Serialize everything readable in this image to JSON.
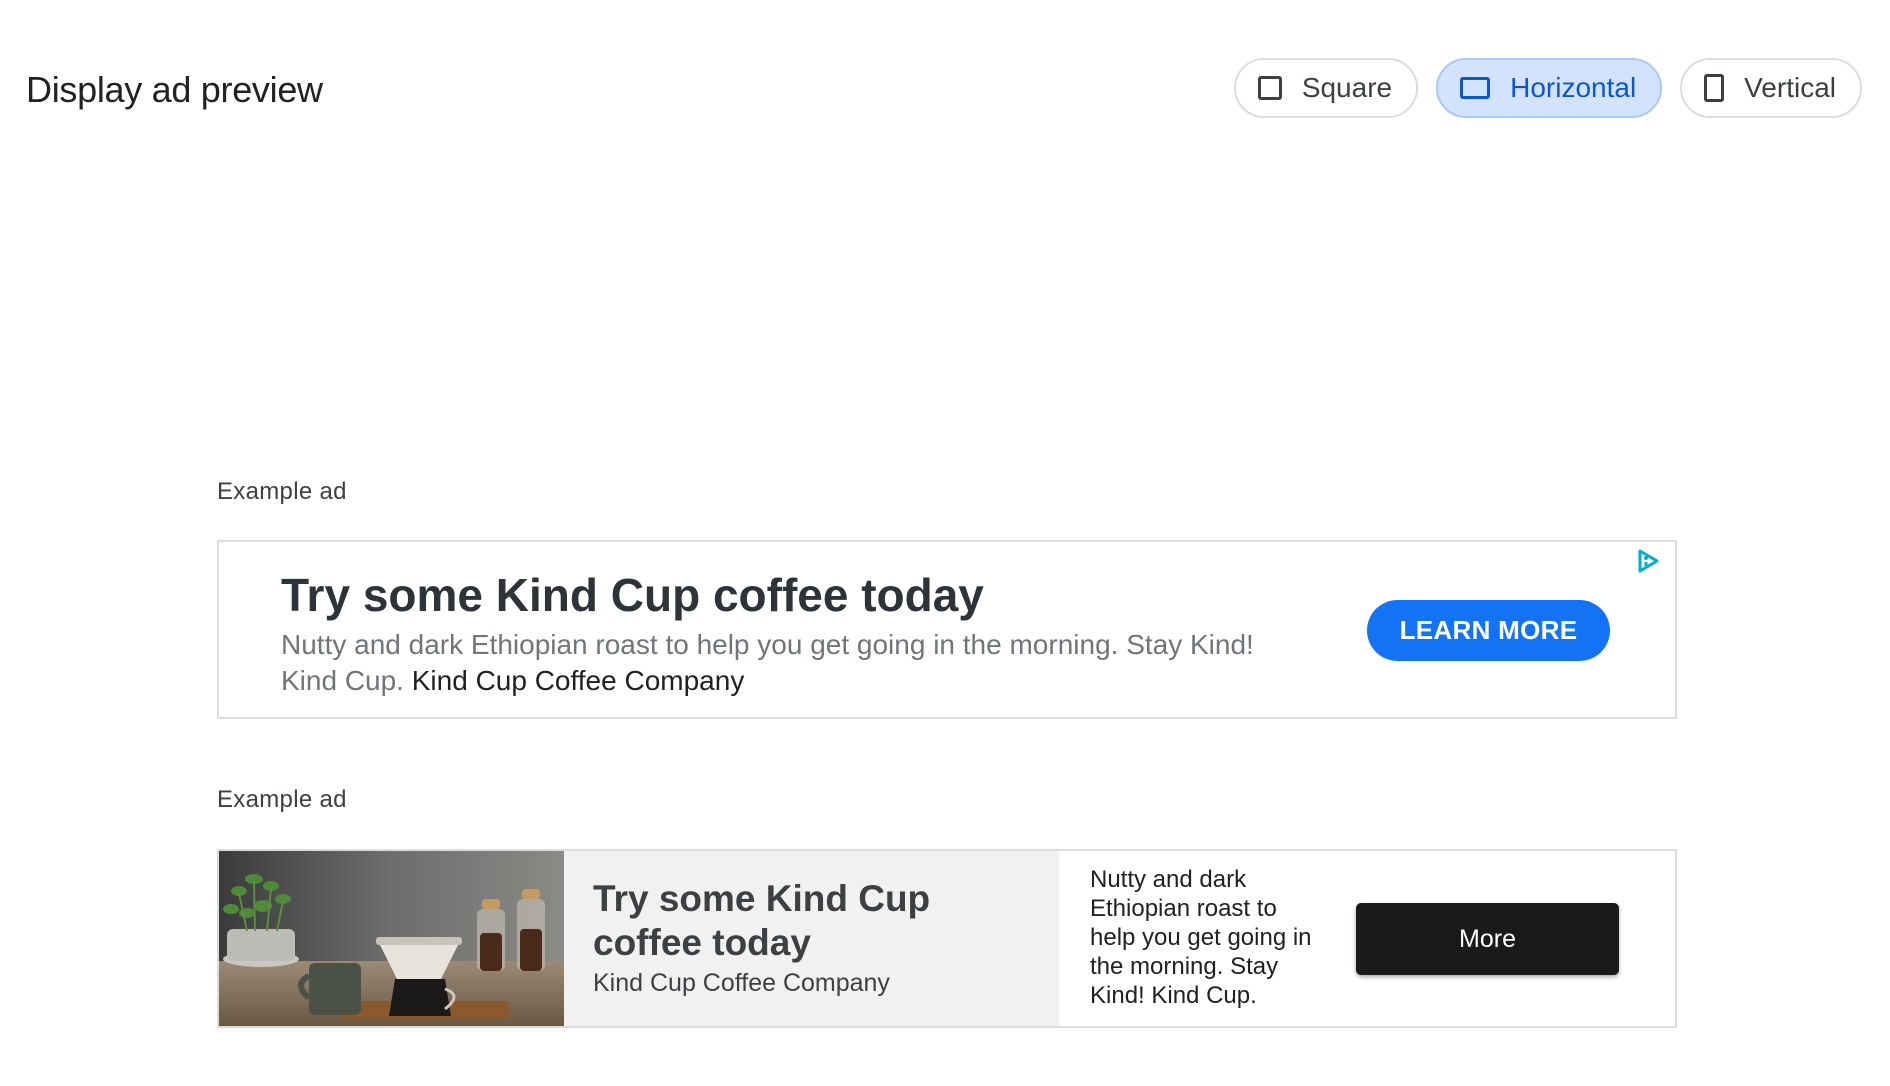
{
  "page": {
    "title": "Display ad preview"
  },
  "formats": [
    {
      "label": "Square",
      "icon": "square-format-icon",
      "selected": false
    },
    {
      "label": "Horizontal",
      "icon": "horizontal-format-icon",
      "selected": true
    },
    {
      "label": "Vertical",
      "icon": "vertical-format-icon",
      "selected": false
    }
  ],
  "ad_text": {
    "label": "Example ad",
    "headline": "Try some Kind Cup coffee today",
    "description": "Nutty and dark Ethiopian roast to help you get going in the morning. Stay Kind! Kind Cup.",
    "advertiser": "Kind Cup Coffee Company",
    "cta": "LEARN MORE",
    "adchoices_icon": "adchoices-icon"
  },
  "ad_image": {
    "label": "Example ad",
    "image_icon": "coffee-photo",
    "headline": "Try some Kind Cup coffee today",
    "advertiser": "Kind Cup Coffee Company",
    "description": "Nutty and dark Ethiopian roast to help you get going in the morning. Stay Kind! Kind Cup.",
    "cta": "More"
  },
  "colors": {
    "selected_chip_bg": "#d3e3fd",
    "selected_chip_text": "#0b57d0",
    "learn_more_button": "#1473f5",
    "more_button": "#1a1a1a"
  }
}
